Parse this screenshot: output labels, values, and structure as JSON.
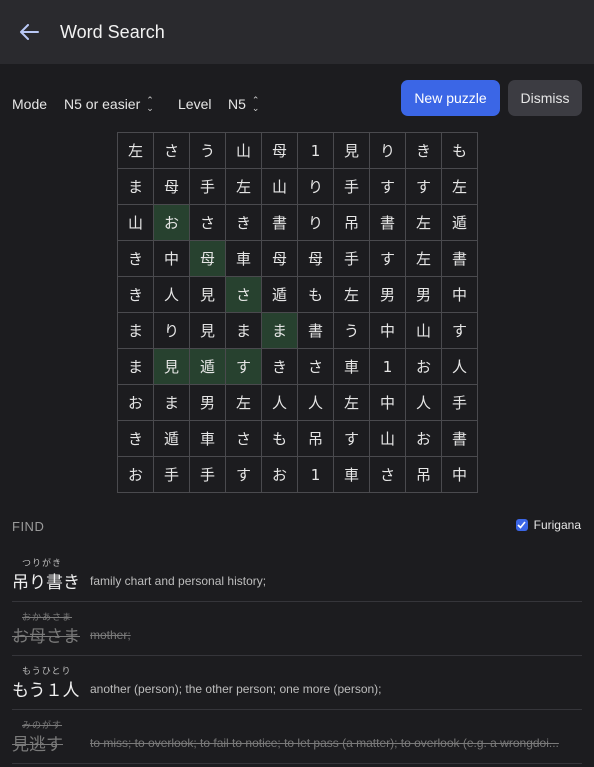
{
  "header": {
    "title": "Word Search"
  },
  "controls": {
    "mode_label": "Mode",
    "mode_value": "N5 or easier",
    "level_label": "Level",
    "level_value": "N5",
    "new_puzzle_label": "New puzzle",
    "dismiss_label": "Dismiss"
  },
  "grid": {
    "rows": [
      [
        "左",
        "さ",
        "う",
        "山",
        "母",
        "1",
        "見",
        "り",
        "き",
        "も"
      ],
      [
        "ま",
        "母",
        "手",
        "左",
        "山",
        "り",
        "手",
        "す",
        "す",
        "左"
      ],
      [
        "山",
        "お",
        "さ",
        "き",
        "書",
        "り",
        "吊",
        "書",
        "左",
        "遁"
      ],
      [
        "き",
        "中",
        "母",
        "車",
        "母",
        "母",
        "手",
        "す",
        "左",
        "書"
      ],
      [
        "き",
        "人",
        "見",
        "さ",
        "遁",
        "も",
        "左",
        "男",
        "男",
        "中"
      ],
      [
        "ま",
        "り",
        "見",
        "ま",
        "ま",
        "書",
        "う",
        "中",
        "山",
        "す"
      ],
      [
        "ま",
        "見",
        "遁",
        "す",
        "き",
        "さ",
        "車",
        "1",
        "お",
        "人"
      ],
      [
        "お",
        "ま",
        "男",
        "左",
        "人",
        "人",
        "左",
        "中",
        "人",
        "手"
      ],
      [
        "き",
        "遁",
        "車",
        "さ",
        "も",
        "吊",
        "す",
        "山",
        "お",
        "書"
      ],
      [
        "お",
        "手",
        "手",
        "す",
        "お",
        "1",
        "車",
        "さ",
        "吊",
        "中"
      ]
    ],
    "highlight": [
      [
        2,
        1
      ],
      [
        3,
        2
      ],
      [
        4,
        3
      ],
      [
        5,
        4
      ],
      [
        6,
        1
      ],
      [
        6,
        2
      ],
      [
        6,
        3
      ]
    ],
    "highlight_color": "#27412f"
  },
  "find": {
    "heading": "FIND",
    "furigana_label": "Furigana",
    "furigana_checked": true,
    "words": [
      {
        "reading": "つりがき",
        "term": "吊り書き",
        "definition": "family chart and personal history;",
        "found": false
      },
      {
        "reading": "おかあさま",
        "term": "お母さま",
        "definition": "mother;",
        "found": true
      },
      {
        "reading": "もうひとり",
        "term": "もう１人",
        "definition": "another (person); the other person; one more (person);",
        "found": false
      },
      {
        "reading": "みのがす",
        "term": "見逃す",
        "definition": "to miss; to overlook; to fail to notice; to let pass (a matter); to overlook (e.g. a wrongdoi...",
        "found": true
      }
    ]
  },
  "colors": {
    "accent": "#3b66e6",
    "background": "#1c1c1f",
    "header": "#2a2a2e"
  }
}
